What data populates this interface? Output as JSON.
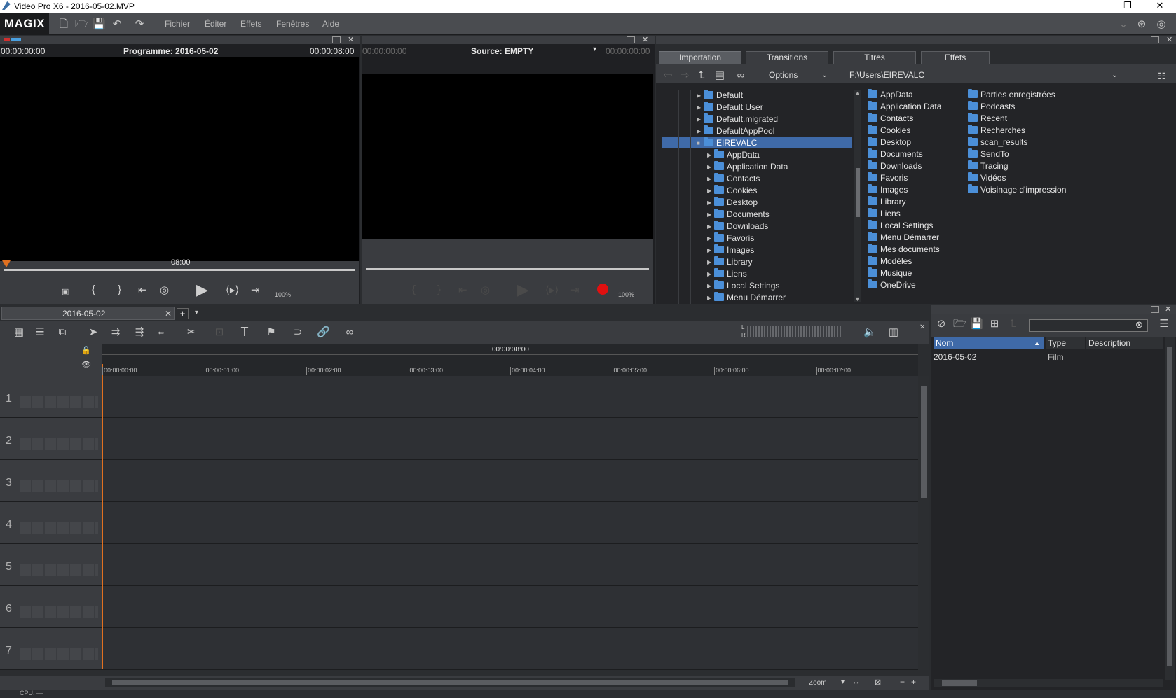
{
  "window": {
    "title": "Video Pro X6 - 2016-05-02.MVP",
    "controls": [
      "—",
      "❐",
      "✕"
    ]
  },
  "menubar": {
    "logo": "MAGIX",
    "items": [
      "Fichier",
      "Éditer",
      "Effets",
      "Fenêtres",
      "Aide"
    ]
  },
  "program_monitor": {
    "timecode_left": "00:00:00:00",
    "title": "Programme: 2016-05-02",
    "timecode_right": "00:00:08:00",
    "scrub_label": "08:00",
    "zoom": "100%"
  },
  "source_monitor": {
    "timecode_left": "00:00:00:00",
    "title": "Source: EMPTY",
    "timecode_right": "00:00:00:00",
    "zoom": "100%"
  },
  "media_pool": {
    "tabs": [
      "Importation",
      "Transitions",
      "Titres",
      "Effets"
    ],
    "active_tab": "Importation",
    "options_label": "Options",
    "path": "F:\\Users\\EIREVALC",
    "tree": [
      {
        "label": "Default",
        "level": 0
      },
      {
        "label": "Default User",
        "level": 0
      },
      {
        "label": "Default.migrated",
        "level": 0
      },
      {
        "label": "DefaultAppPool",
        "level": 0
      },
      {
        "label": "EIREVALC",
        "level": 0,
        "selected": true
      },
      {
        "label": "AppData",
        "level": 1
      },
      {
        "label": "Application Data",
        "level": 1
      },
      {
        "label": "Contacts",
        "level": 1
      },
      {
        "label": "Cookies",
        "level": 1
      },
      {
        "label": "Desktop",
        "level": 1
      },
      {
        "label": "Documents",
        "level": 1
      },
      {
        "label": "Downloads",
        "level": 1
      },
      {
        "label": "Favoris",
        "level": 1
      },
      {
        "label": "Images",
        "level": 1
      },
      {
        "label": "Library",
        "level": 1
      },
      {
        "label": "Liens",
        "level": 1
      },
      {
        "label": "Local Settings",
        "level": 1
      },
      {
        "label": "Menu Démarrer",
        "level": 1
      }
    ],
    "files_col1": [
      "AppData",
      "Application Data",
      "Contacts",
      "Cookies",
      "Desktop",
      "Documents",
      "Downloads",
      "Favoris",
      "Images",
      "Library",
      "Liens",
      "Local Settings",
      "Menu Démarrer",
      "Mes documents",
      "Modèles",
      "Musique",
      "OneDrive"
    ],
    "files_col2": [
      "Parties enregistrées",
      "Podcasts",
      "Recent",
      "Recherches",
      "scan_results",
      "SendTo",
      "Tracing",
      "Vidéos",
      "Voisinage d'impression"
    ]
  },
  "timeline": {
    "tab_label": "2016-05-02",
    "add_tab": "+",
    "duration": "00:00:08:00",
    "ruler": [
      "00:00:00:00",
      "00:00:01:00",
      "00:00:02:00",
      "00:00:03:00",
      "00:00:04:00",
      "00:00:05:00",
      "00:00:06:00",
      "00:00:07:00"
    ],
    "tracks": [
      "1",
      "2",
      "3",
      "4",
      "5",
      "6",
      "7"
    ],
    "zoom_label": "Zoom",
    "lr": [
      "L",
      "R"
    ]
  },
  "project_panel": {
    "columns": [
      "Nom",
      "Type",
      "Description"
    ],
    "rows": [
      {
        "name": "2016-05-02",
        "type": "Film",
        "description": ""
      }
    ]
  },
  "status": {
    "cpu": "CPU: —"
  }
}
